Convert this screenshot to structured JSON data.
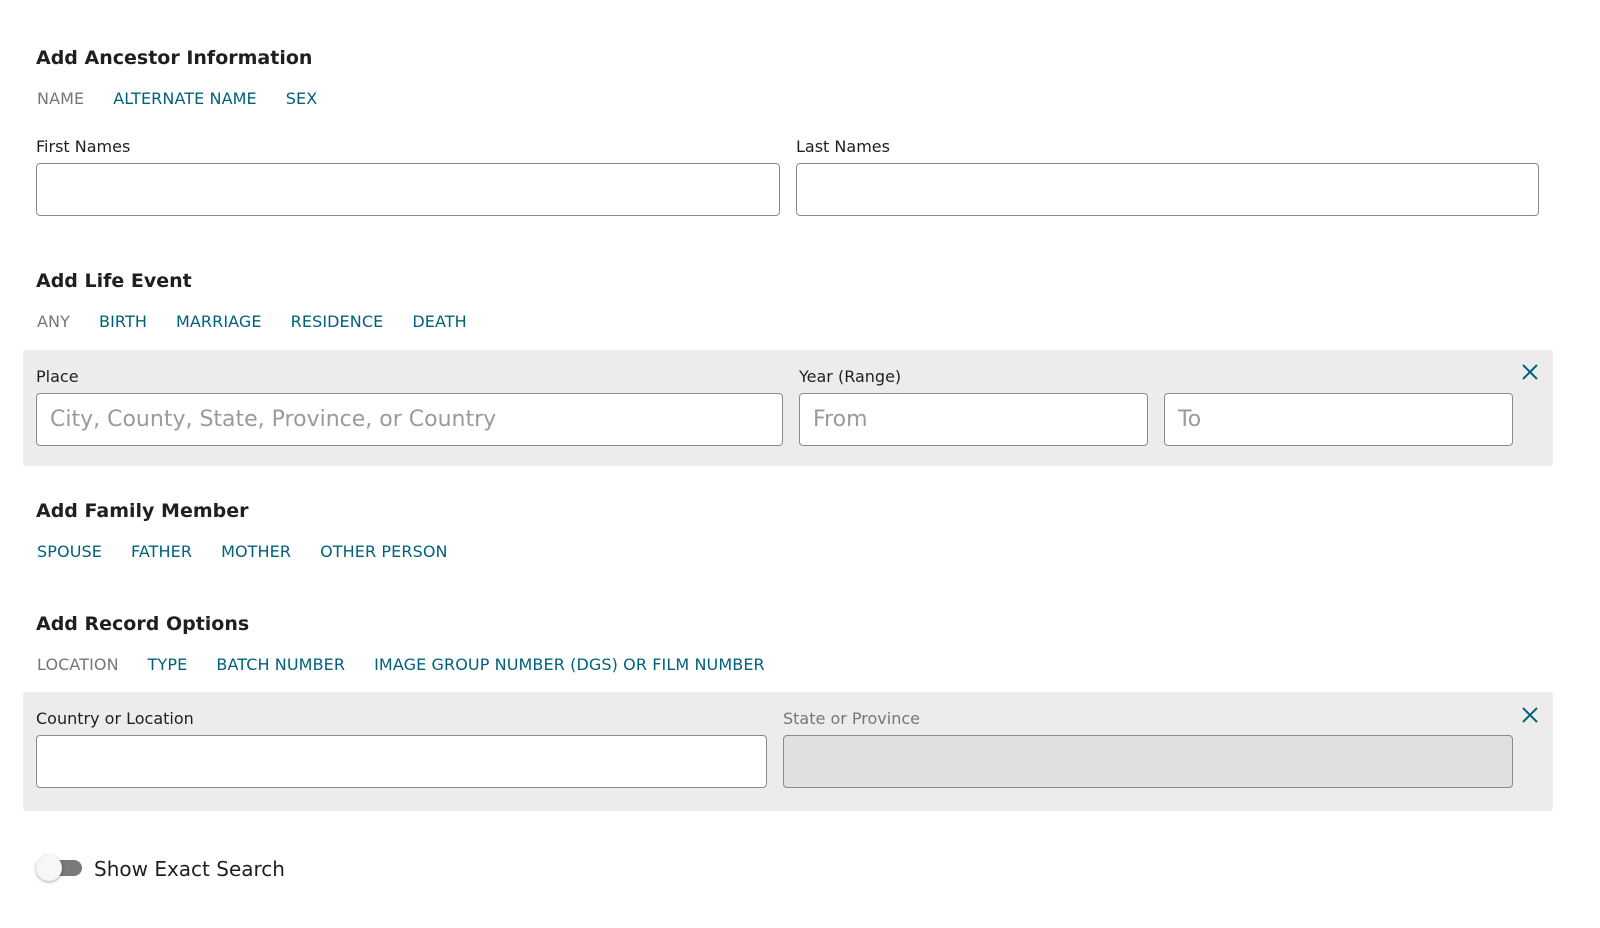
{
  "ancestor": {
    "heading": "Add Ancestor Information",
    "tabs": [
      {
        "label": "NAME",
        "active": true
      },
      {
        "label": "ALTERNATE NAME",
        "active": false
      },
      {
        "label": "SEX",
        "active": false
      }
    ],
    "first_names_label": "First Names",
    "first_names_value": "",
    "last_names_label": "Last Names",
    "last_names_value": ""
  },
  "life_event": {
    "heading": "Add Life Event",
    "tabs": [
      {
        "label": "ANY",
        "active": true
      },
      {
        "label": "BIRTH",
        "active": false
      },
      {
        "label": "MARRIAGE",
        "active": false
      },
      {
        "label": "RESIDENCE",
        "active": false
      },
      {
        "label": "DEATH",
        "active": false
      }
    ],
    "place_label": "Place",
    "place_placeholder": "City, County, State, Province, or Country",
    "year_label": "Year (Range)",
    "from_placeholder": "From",
    "to_placeholder": "To",
    "close_icon": "close-icon"
  },
  "family": {
    "heading": "Add Family Member",
    "tabs": [
      {
        "label": "SPOUSE"
      },
      {
        "label": "FATHER"
      },
      {
        "label": "MOTHER"
      },
      {
        "label": "OTHER PERSON"
      }
    ]
  },
  "record": {
    "heading": "Add Record Options",
    "tabs": [
      {
        "label": "LOCATION",
        "active": true
      },
      {
        "label": "TYPE",
        "active": false
      },
      {
        "label": "BATCH NUMBER",
        "active": false
      },
      {
        "label": "IMAGE GROUP NUMBER (DGS) OR FILM NUMBER",
        "active": false
      }
    ],
    "country_label": "Country or Location",
    "country_value": "",
    "state_label": "State or Province",
    "state_value": "",
    "close_icon": "close-icon"
  },
  "exact_search": {
    "label": "Show Exact Search",
    "enabled": false
  },
  "colors": {
    "link": "#00617a",
    "inactive_tab": "#767676",
    "panel_bg": "#ececec",
    "disabled_input": "#dfe0e0"
  }
}
